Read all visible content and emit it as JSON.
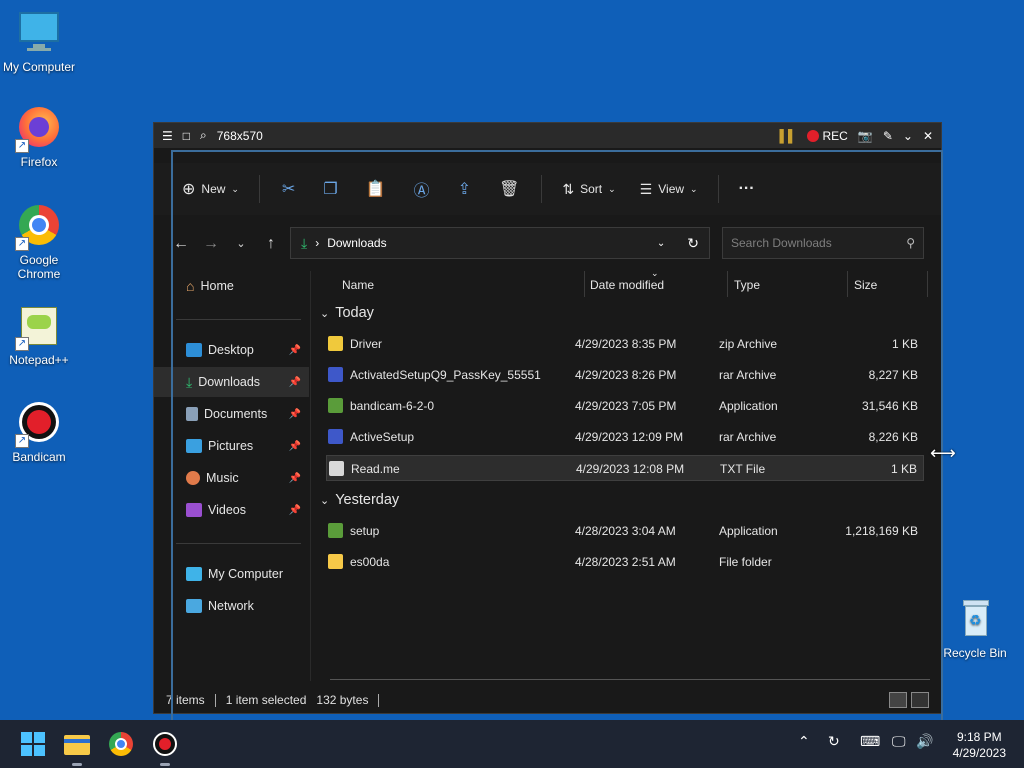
{
  "desktop": {
    "icons": [
      {
        "label": "My Computer"
      },
      {
        "label": "Firefox"
      },
      {
        "label": "Google Chrome"
      },
      {
        "label": "Notepad++"
      },
      {
        "label": "Bandicam"
      },
      {
        "label": "Recycle Bin"
      }
    ]
  },
  "recorder": {
    "size_label": "768x570",
    "rec_label": "REC"
  },
  "toolbar": {
    "new_label": "New",
    "sort_label": "Sort",
    "view_label": "View",
    "more_label": "···"
  },
  "address": {
    "path": "Downloads",
    "search_placeholder": "Search Downloads"
  },
  "sidebar": {
    "items": [
      {
        "label": "Home"
      },
      {
        "label": "Desktop"
      },
      {
        "label": "Downloads"
      },
      {
        "label": "Documents"
      },
      {
        "label": "Pictures"
      },
      {
        "label": "Music"
      },
      {
        "label": "Videos"
      },
      {
        "label": "My Computer"
      },
      {
        "label": "Network"
      }
    ]
  },
  "columns": {
    "name": "Name",
    "date": "Date modified",
    "type": "Type",
    "size": "Size"
  },
  "groups": [
    {
      "label": "Today",
      "files": [
        {
          "name": "Driver",
          "date": "4/29/2023 8:35 PM",
          "type": "zip Archive",
          "size": "1 KB"
        },
        {
          "name": "ActivatedSetupQ9_PassKey_55551",
          "date": "4/29/2023 8:26 PM",
          "type": "rar Archive",
          "size": "8,227 KB"
        },
        {
          "name": "bandicam-6-2-0",
          "date": "4/29/2023 7:05 PM",
          "type": "Application",
          "size": "31,546 KB"
        },
        {
          "name": "ActiveSetup",
          "date": "4/29/2023 12:09 PM",
          "type": "rar Archive",
          "size": "8,226 KB"
        },
        {
          "name": "Read.me",
          "date": "4/29/2023 12:08 PM",
          "type": "TXT File",
          "size": "1 KB"
        }
      ]
    },
    {
      "label": "Yesterday",
      "files": [
        {
          "name": "setup",
          "date": "4/28/2023 3:04 AM",
          "type": "Application",
          "size": "1,218,169 KB"
        },
        {
          "name": "es00da",
          "date": "4/28/2023 2:51 AM",
          "type": "File folder",
          "size": ""
        }
      ]
    }
  ],
  "status": {
    "items": "7 items",
    "selected": "1 item selected",
    "bytes": "132 bytes"
  },
  "clock": {
    "time": "9:18 PM",
    "date": "4/29/2023"
  }
}
